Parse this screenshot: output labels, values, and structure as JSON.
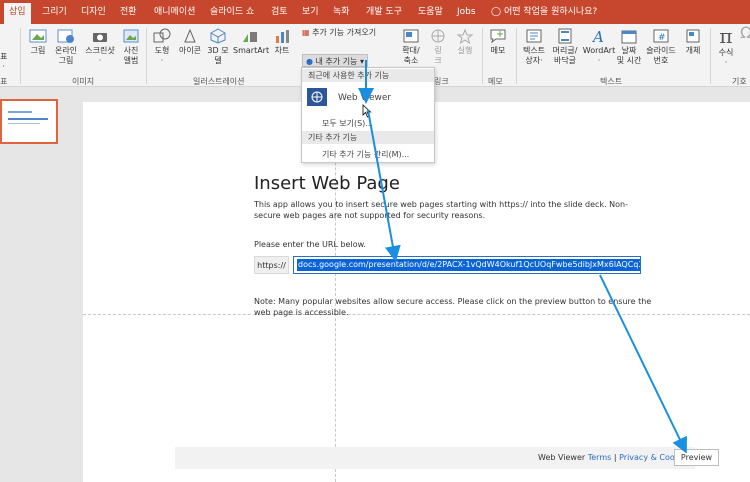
{
  "tabs": [
    "삽입",
    "그리기",
    "디자인",
    "전환",
    "애니메이션",
    "슬라이드 쇼",
    "검토",
    "보기",
    "녹화",
    "개발 도구",
    "도움말",
    "Jobs"
  ],
  "tell_me": "어떤 작업을 원하시나요?",
  "ribbon": {
    "left_cut_1": "표",
    "left_cut_2": "·",
    "picture": "그림",
    "online_picture": [
      "온라인",
      "그림"
    ],
    "screenshot": "스크린샷",
    "photo_album": [
      "사진",
      "앨범"
    ],
    "shapes": "도형",
    "icons": "아이콘",
    "models_3d": [
      "3D 모",
      "델"
    ],
    "smartart": "SmartArt",
    "chart": "차트",
    "get_addins": "추가 기능 가져오기",
    "my_addins": "내 추가 기능",
    "zoom": [
      "확대/",
      "축소"
    ],
    "link": [
      "링",
      "크"
    ],
    "action": "실행",
    "comment": "메모",
    "textbox": [
      "텍스트",
      "상자"
    ],
    "header_footer": [
      "머리글/",
      "바닥글"
    ],
    "wordart": "WordArt",
    "date_time": [
      "날짜",
      "및 시간"
    ],
    "slide_number": [
      "슬라이드",
      "번호"
    ],
    "object": "개체",
    "equation": "수식",
    "group_table": "표",
    "group_images": "이미지",
    "group_illustrations": "일러스트레이션",
    "group_links": "링크",
    "group_comments": "메모",
    "group_text": "텍스트",
    "group_symbols": "기호"
  },
  "dropdown": {
    "recent_header": "최근에 사용한 추가 기능",
    "web_viewer": "Web Viewer",
    "see_all": "모두 보기(S)...",
    "other_header": "기타 추가 기능",
    "manage_other": "기타 추가 기능 관리(M)..."
  },
  "webpage": {
    "title": "Insert Web Page",
    "desc": "This app allows you to insert secure web pages starting with https:// into the slide deck. Non-secure web pages are not supported for security reasons.",
    "prompt": "Please enter the URL below.",
    "prefix": "https://",
    "url_value": "docs.google.com/presentation/d/e/2PACX-1vQdW4Okuf1QcUOqFwbe5dibJxMx6IAQCq37xrmyC",
    "note": "Note: Many popular websites allow secure access. Please click on the preview button to ensure the web page is accessible.",
    "footer_app": "Web Viewer",
    "footer_terms": "Terms",
    "footer_sep": "|",
    "footer_privacy": "Privacy & Cookies",
    "preview_btn": "Preview"
  },
  "colors": {
    "accent": "#c7472e",
    "arrow": "#1a8fe0",
    "selection": "#0a64d8"
  }
}
